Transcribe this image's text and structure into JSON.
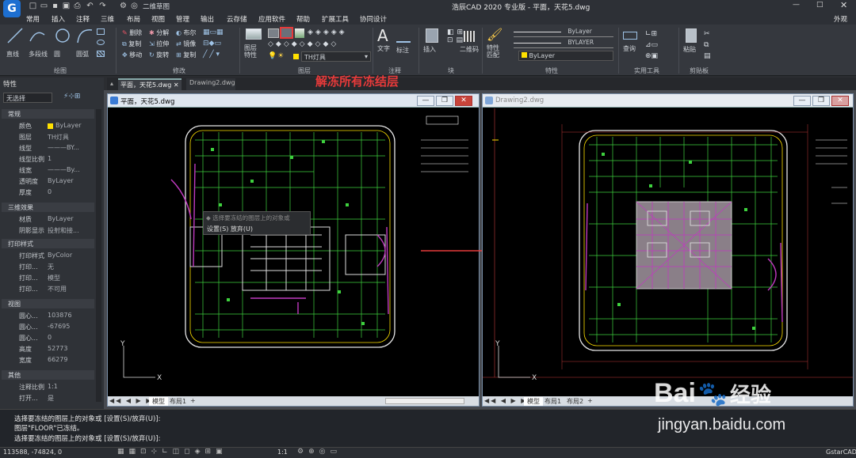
{
  "app": {
    "title": "浩辰CAD 2020 专业版 - 平面，天花5.dwg",
    "workspace": "二维草图",
    "right_label": "外观"
  },
  "menu": [
    "常用",
    "插入",
    "注释",
    "三维",
    "布局",
    "视图",
    "管理",
    "输出",
    "云存储",
    "应用软件",
    "帮助",
    "扩展工具",
    "协同设计"
  ],
  "ribbon": {
    "draw_label": "绘图",
    "modify_label": "修改",
    "layer_label": "图层",
    "annotation_label": "注释",
    "block_label": "块",
    "props_label": "特性",
    "utilities_label": "实用工具",
    "clipboard_label": "剪贴板",
    "buttons": {
      "line": "直线",
      "polyline": "多段线",
      "circle": "圆",
      "arc": "圆弧",
      "delete": "删除",
      "copy": "复制",
      "move": "移动",
      "fillet": "分解",
      "stretch": "拉伸",
      "rotate": "旋转",
      "boolean": "布尔",
      "mirror": "镜像",
      "trim": "复制",
      "layer_props": "图层\n特性",
      "current_layer": "TH灯具",
      "text": "文字",
      "dimension": "标注",
      "insert": "插入",
      "qr": "二维码",
      "match": "特性\n匹配",
      "color": "ByLayer",
      "linetype": "ByLayer",
      "lineweight": "BYLAYER",
      "measure": "查询",
      "paste": "粘贴"
    }
  },
  "annotation_text": "解冻所有冻结层",
  "doc_tabs": [
    "平面，天花5.dwg",
    "Drawing2.dwg"
  ],
  "properties": {
    "panel_title": "特性",
    "selection": "无选择",
    "sections": [
      {
        "title": "常规",
        "rows": [
          [
            "颜色",
            "ByLayer"
          ],
          [
            "图层",
            "TH灯具"
          ],
          [
            "线型",
            "———BY..."
          ],
          [
            "线型比例",
            "1"
          ],
          [
            "线宽",
            "———By..."
          ],
          [
            "透明度",
            "ByLayer"
          ],
          [
            "厚度",
            "0"
          ]
        ]
      },
      {
        "title": "三维效果",
        "rows": [
          [
            "材质",
            "ByLayer"
          ],
          [
            "阴影显示",
            "投射和接..."
          ]
        ]
      },
      {
        "title": "打印样式",
        "rows": [
          [
            "打印样式",
            "ByColor"
          ],
          [
            "打印...",
            "无"
          ],
          [
            "打印...",
            "模型"
          ],
          [
            "打印...",
            "不可用"
          ]
        ]
      },
      {
        "title": "视图",
        "rows": [
          [
            "圆心...",
            "103876"
          ],
          [
            "圆心...",
            "-67695"
          ],
          [
            "圆心...",
            "0"
          ],
          [
            "高度",
            "52773"
          ],
          [
            "宽度",
            "66279"
          ]
        ]
      },
      {
        "title": "其他",
        "rows": [
          [
            "注释比例",
            "1:1"
          ],
          [
            "打开...",
            "是"
          ]
        ]
      }
    ]
  },
  "window1": {
    "title": "平面，天花5.dwg",
    "tab_model": "模型",
    "tab_layout1": "布局1"
  },
  "window2": {
    "title": "Drawing2.dwg",
    "tab_model": "模型",
    "tab_layout1": "布局1",
    "tab_layout2": "布局2"
  },
  "popup": {
    "prompt": "选择要冻结的图层上的对象或",
    "options": "设置(S)   放弃(U)"
  },
  "command": {
    "lines": [
      "选择要冻结的图层上的对象或 [设置(S)/放弃(U)]:",
      "图层\"FLOOR\"已冻结。",
      "选择要冻结的图层上的对象或 [设置(S)/放弃(U)]:"
    ]
  },
  "status": {
    "coords": "113588, -74824, 0",
    "scale": "1:1",
    "brand": "GstarCAD"
  },
  "watermark": {
    "brand": "Bai",
    "brand2": "经验",
    "url": "jingyan.baidu.com"
  },
  "colors": {
    "accent": "#c8443a",
    "layer_yellow": "#ffe100",
    "annotation_red": "#e83a3a"
  }
}
